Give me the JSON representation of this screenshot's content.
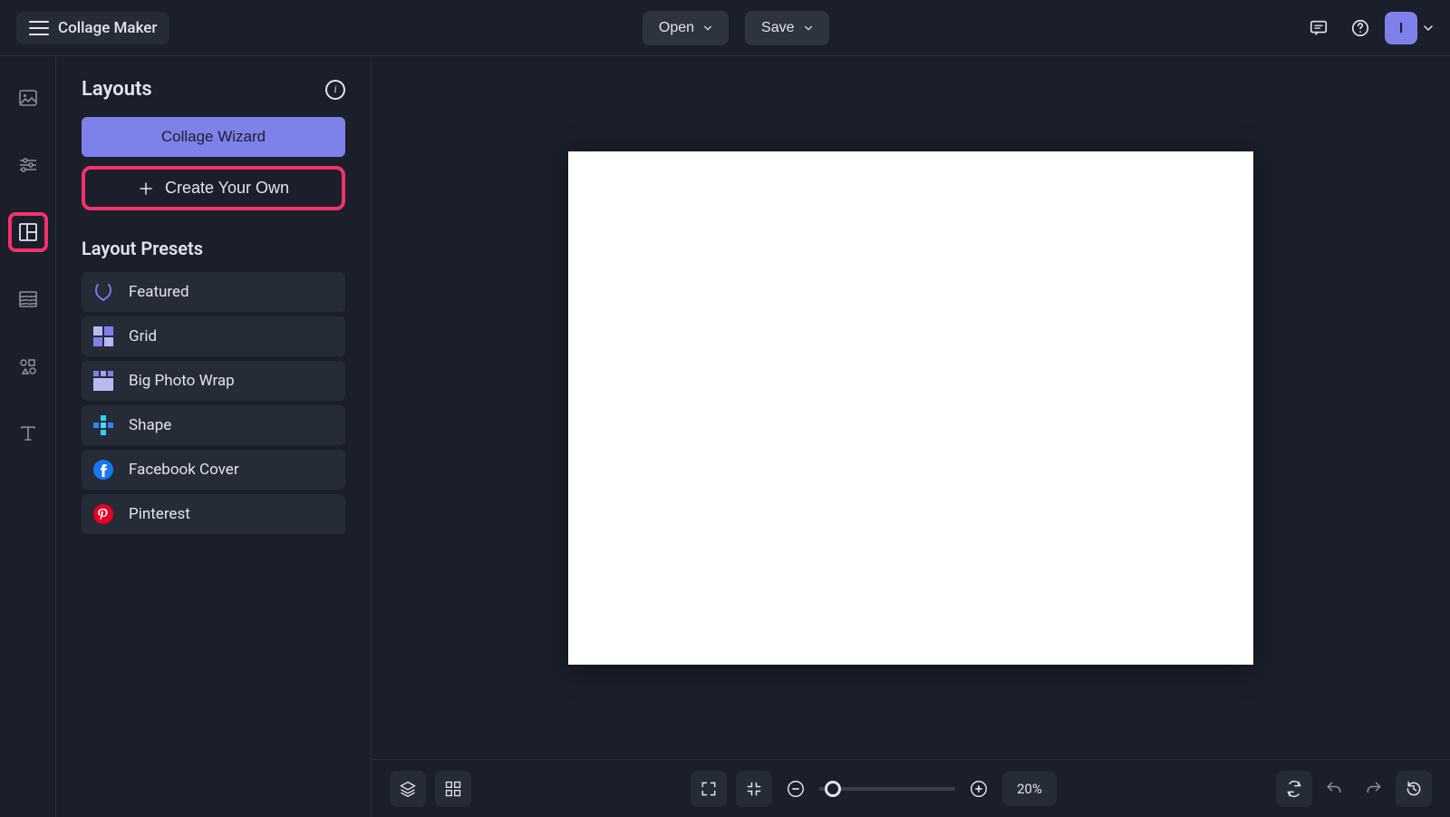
{
  "header": {
    "title": "Collage Maker",
    "open": "Open",
    "save": "Save",
    "avatar_initial": "I"
  },
  "rail": {
    "items": [
      {
        "id": "photos",
        "icon": "image-icon"
      },
      {
        "id": "adjust",
        "icon": "sliders-icon"
      },
      {
        "id": "layouts",
        "icon": "layout-icon",
        "active": true,
        "highlighted": true
      },
      {
        "id": "textures",
        "icon": "texture-icon"
      },
      {
        "id": "shapes",
        "icon": "shapes-icon"
      },
      {
        "id": "text",
        "icon": "text-icon"
      }
    ]
  },
  "panel": {
    "title": "Layouts",
    "wizard": "Collage Wizard",
    "create": "Create Your Own",
    "presets_title": "Layout Presets",
    "presets": [
      {
        "id": "featured",
        "label": "Featured",
        "icon": "wreath-icon"
      },
      {
        "id": "grid",
        "label": "Grid",
        "icon": "grid4-icon"
      },
      {
        "id": "bigphoto",
        "label": "Big Photo Wrap",
        "icon": "bigphoto-icon"
      },
      {
        "id": "shape",
        "label": "Shape",
        "icon": "plus-shape-icon"
      },
      {
        "id": "facebook",
        "label": "Facebook Cover",
        "icon": "facebook-icon"
      },
      {
        "id": "pinterest",
        "label": "Pinterest",
        "icon": "pinterest-icon"
      }
    ]
  },
  "bottombar": {
    "zoom_value": "20%"
  }
}
